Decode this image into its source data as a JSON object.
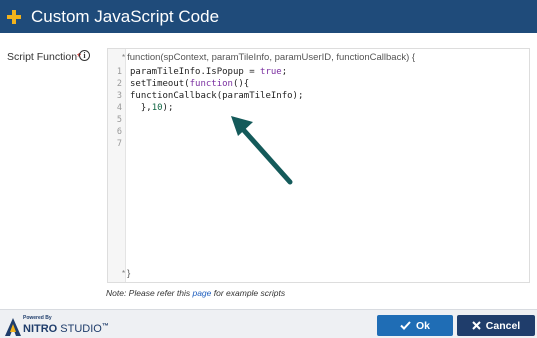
{
  "dialog": {
    "title": "Custom JavaScript Code",
    "accent_color": "#f2b21c",
    "header_color": "#1f4b7a"
  },
  "field": {
    "label": "Script Function",
    "required_marker": "*",
    "info_symbol": "i"
  },
  "editor": {
    "signature": "function(spContext, paramTileInfo, paramUserID, functionCallback) {",
    "closing": "}",
    "marker": "*",
    "line_numbers": [
      "1",
      "2",
      "3",
      "4",
      "5",
      "6",
      "7"
    ],
    "lines": [
      "paramTileInfo.IsPopup = true;",
      "setTimeout(function(){",
      "functionCallback(paramTileInfo);",
      "  },10);",
      "",
      "",
      ""
    ]
  },
  "note": {
    "prefix": "Note: Please refer this ",
    "link": "page",
    "suffix": " for example scripts"
  },
  "footer": {
    "powered_by": "Powered By",
    "brand_main": "NITRO",
    "brand_sub": "STUDIO",
    "trademark": "™",
    "ok_label": "Ok",
    "cancel_label": "Cancel"
  }
}
